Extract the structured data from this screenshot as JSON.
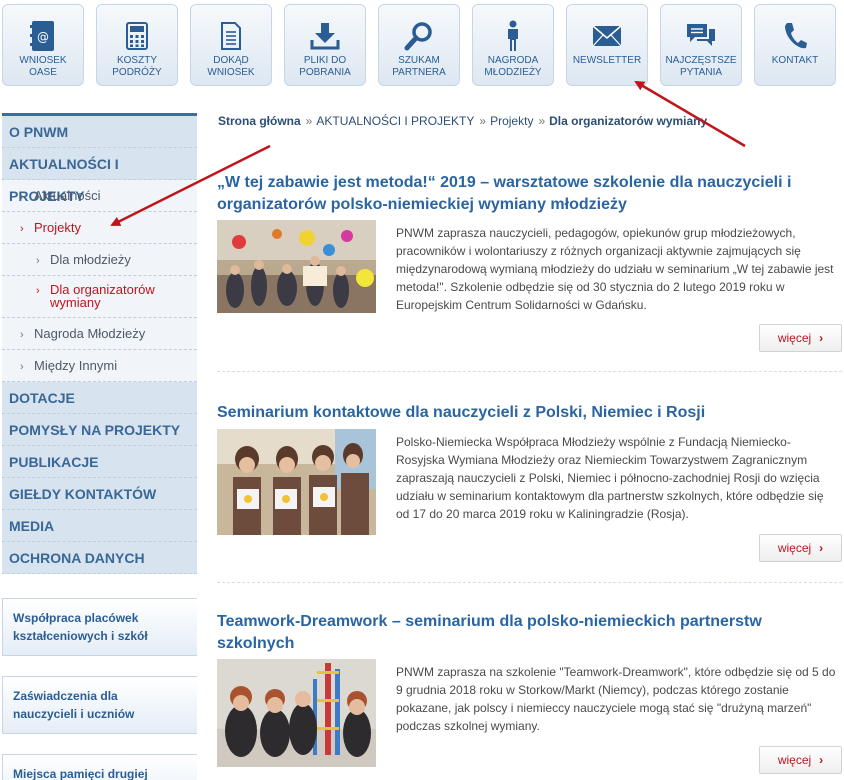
{
  "topnav": [
    {
      "label": "WNIOSEK OASE",
      "icon": "address-book-icon"
    },
    {
      "label": "KOSZTY PODRÓŻY",
      "icon": "calculator-icon"
    },
    {
      "label": "DOKĄD WNIOSEK",
      "icon": "document-icon"
    },
    {
      "label": "PLIKI DO POBRANIA",
      "icon": "download-icon"
    },
    {
      "label": "SZUKAM PARTNERA",
      "icon": "search-icon"
    },
    {
      "label": "NAGRODA MŁODZIEŻY",
      "icon": "person-icon"
    },
    {
      "label": "NEWSLETTER",
      "icon": "envelope-icon"
    },
    {
      "label": "NAJCZĘSTSZE PYTANIA",
      "icon": "chat-bubbles-icon"
    },
    {
      "label": "KONTAKT",
      "icon": "phone-icon"
    }
  ],
  "sidebar": {
    "items": [
      {
        "label": "O PNWM"
      },
      {
        "label": "AKTUALNOŚCI I PROJEKTY"
      },
      {
        "label": "Aktualności"
      },
      {
        "label": "Projekty"
      },
      {
        "label": "Dla młodzieży"
      },
      {
        "label": "Dla organizatorów wymiany"
      },
      {
        "label": "Nagroda Młodzieży"
      },
      {
        "label": "Między Innymi"
      },
      {
        "label": "DOTACJE"
      },
      {
        "label": "POMYSŁY NA PROJEKTY"
      },
      {
        "label": "PUBLIKACJE"
      },
      {
        "label": "GIEŁDY KONTAKTÓW"
      },
      {
        "label": "MEDIA"
      },
      {
        "label": "OCHRONA DANYCH"
      }
    ],
    "chevron": "›"
  },
  "promos": [
    {
      "label": "Współpraca placówek kształceniowych i szkół"
    },
    {
      "label": "Zaświadczenia dla nauczycieli i uczniów"
    },
    {
      "label": "Miejsca pamięci drugiej"
    }
  ],
  "breadcrumb": {
    "home": "Strona główna",
    "sep": "»",
    "level1": "AKTUALNOŚCI I PROJEKTY",
    "level2": "Projekty",
    "current": "Dla organizatorów wymiany"
  },
  "articles": [
    {
      "title": "„W tej zabawie jest metoda!“ 2019 – warsztatowe szkolenie dla nauczycieli i organizatorów polsko-niemieckiej wymiany młodzieży",
      "text": "PNWM zaprasza nauczycieli, pedagogów, opiekunów grup młodzieżowych, pracowników i wolontariuszy z różnych organizacji aktywnie zajmujących się międzynarodową wymianą młodzieży do udziału w seminarium „W tej zabawie jest metoda!\". Szkolenie odbędzie się od 30 stycznia do 2 lutego 2019 roku w Europejskim Centrum Solidarności w Gdańsku.",
      "more": "więcej"
    },
    {
      "title": "Seminarium kontaktowe dla nauczycieli z Polski, Niemiec i Rosji",
      "text": "Polsko-Niemiecka Współpraca Młodzieży wspólnie z Fundacją Niemiecko-Rosyjska Wymiana Młodzieży oraz Niemieckim Towarzystwem Zagranicznym zapraszają nauczycieli z Polski, Niemiec i północno-zachodniej Rosji do wzięcia udziału w seminarium kontaktowym dla partnerstw szkolnych, które odbędzie się od 17 do 20 marca 2019 roku w Kaliningradzie (Rosja).",
      "more": "więcej"
    },
    {
      "title": "Teamwork-Dreamwork – seminarium dla polsko-niemieckich partnerstw szkolnych",
      "text": "PNWM zaprasza na szkolenie \"Teamwork-Dreamwork\", które odbędzie się od 5 do 9 grudnia 2018 roku w Storkow/Markt (Niemcy), podczas którego zostanie pokazane, jak polscy i niemieccy nauczyciele mogą stać się \"drużyną marzeń\" podczas szkolnej wymiany.",
      "more": "więcej"
    }
  ],
  "more_arrow": "›",
  "colors": {
    "accent": "#2a65a3",
    "active": "#c0141b",
    "annotation": "#c0141b"
  }
}
